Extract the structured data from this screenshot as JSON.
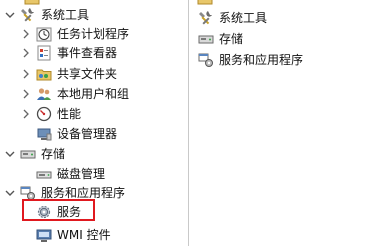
{
  "tree": {
    "items": [
      {
        "label": "系统工具",
        "icon": "tools-icon",
        "expanded": true
      },
      {
        "label": "任务计划程序",
        "icon": "clock-icon"
      },
      {
        "label": "事件查看器",
        "icon": "event-viewer-icon"
      },
      {
        "label": "共享文件夹",
        "icon": "shared-folder-icon"
      },
      {
        "label": "本地用户和组",
        "icon": "users-icon"
      },
      {
        "label": "性能",
        "icon": "performance-icon"
      },
      {
        "label": "设备管理器",
        "icon": "device-manager-icon"
      },
      {
        "label": "存储",
        "icon": "storage-icon",
        "expanded": true
      },
      {
        "label": "磁盘管理",
        "icon": "disk-icon"
      },
      {
        "label": "服务和应用程序",
        "icon": "services-apps-icon",
        "expanded": true
      },
      {
        "label": "服务",
        "icon": "gear-icon",
        "selected_highlight": true
      },
      {
        "label": "WMI 控件",
        "icon": "wmi-icon"
      }
    ]
  },
  "list": {
    "items": [
      {
        "label": "系统工具",
        "icon": "tools-icon"
      },
      {
        "label": "存储",
        "icon": "storage-icon"
      },
      {
        "label": "服务和应用程序",
        "icon": "services-apps-icon"
      }
    ]
  },
  "colors": {
    "highlight_border": "#e0191f",
    "chevron": "#555555",
    "divider": "#c9c9c9"
  }
}
